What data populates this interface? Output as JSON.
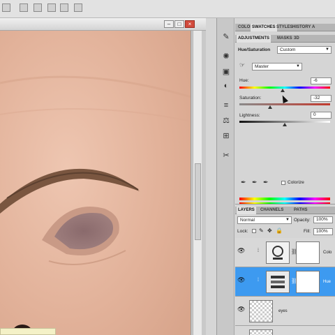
{
  "adjustments": {
    "tabs": [
      "COLOR",
      "SWATCHES",
      "STYLES",
      "HISTORY",
      "A"
    ],
    "subtabs": [
      "ADJUSTMENTS",
      "MASKS",
      "3D"
    ],
    "title": "Hue/Saturation",
    "preset": "Custom",
    "channel": "Master",
    "hue_label": "Hue:",
    "hue_value": "-6",
    "saturation_label": "Saturation:",
    "saturation_value": "-32",
    "lightness_label": "Lightness:",
    "lightness_value": "0",
    "colorize_label": "Colorize",
    "colorize_checked": false,
    "hue_slider_fraction": 0.48,
    "saturation_slider_fraction": 0.34,
    "lightness_slider_fraction": 0.5
  },
  "layers": {
    "tabs": [
      "LAYERS",
      "CHANNELS",
      "PATHS"
    ],
    "blend_mode": "Normal",
    "opacity_label": "Opacity:",
    "opacity_value": "100%",
    "lock_label": "Lock:",
    "fill_label": "Fill:",
    "fill_value": "100%",
    "items": [
      {
        "name": "Colo",
        "selected": false
      },
      {
        "name": "Hue",
        "selected": true
      },
      {
        "name": "eyes",
        "selected": false
      }
    ]
  },
  "colors": {
    "selection": "#3d9af0",
    "close_button": "#d24a3c",
    "skin": "#e7b9a0"
  },
  "icons": [
    "brush-icon",
    "sun-icon",
    "image-icon",
    "circle-icon",
    "levels-icon",
    "balance-icon",
    "mixer-icon",
    "tools-icon"
  ]
}
